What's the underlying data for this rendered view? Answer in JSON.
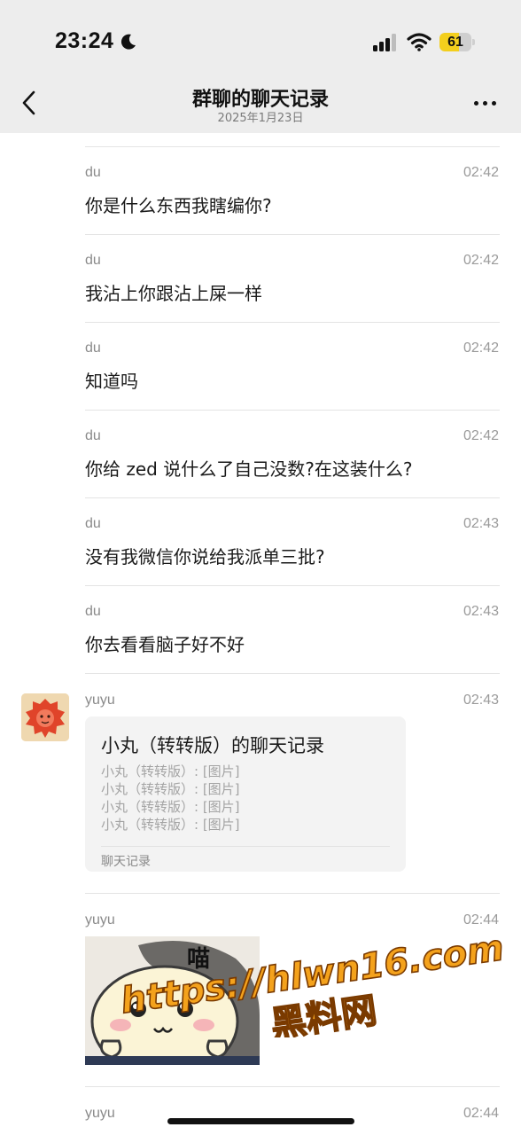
{
  "status_bar": {
    "time": "23:24",
    "moon_icon": "moon-icon",
    "signal_icon": "cellular-signal-icon",
    "wifi_icon": "wifi-icon",
    "battery_level": "61",
    "battery_color": "#f3cf1d"
  },
  "nav": {
    "back_icon": "chevron-left-icon",
    "title": "群聊的聊天记录",
    "subtitle": "2025年1月23日",
    "more_icon": "more-dots-icon"
  },
  "messages": [
    {
      "sender": "du",
      "time": "02:42",
      "text": "你是什么东西我瞎编你?"
    },
    {
      "sender": "du",
      "time": "02:42",
      "text": "我沾上你跟沾上屎一样"
    },
    {
      "sender": "du",
      "time": "02:42",
      "text": "知道吗"
    },
    {
      "sender": "du",
      "time": "02:42",
      "text": "你给 zed 说什么了自己没数?在这装什么?"
    },
    {
      "sender": "du",
      "time": "02:43",
      "text": "没有我微信你说给我派单三批?"
    },
    {
      "sender": "du",
      "time": "02:43",
      "text": "你去看看脑子好不好"
    }
  ],
  "forwarded": {
    "sender": "yuyu",
    "time": "02:43",
    "avatar_icon": "red-lion-avatar",
    "card_title": "小丸（转转版）的聊天记录",
    "card_lines": [
      "小丸（转转版）: [图片]",
      "小丸（转转版）: [图片]",
      "小丸（转转版）: [图片]",
      "小丸（转转版）: [图片]"
    ],
    "card_footer": "聊天记录"
  },
  "image_message": {
    "sender": "yuyu",
    "time": "02:44",
    "sticker_text": "喵"
  },
  "last_message": {
    "sender": "yuyu",
    "time": "02:44"
  },
  "watermark": {
    "url": "https://hlwn16.com",
    "label": "黑料网",
    "color": "#f4a21c"
  }
}
